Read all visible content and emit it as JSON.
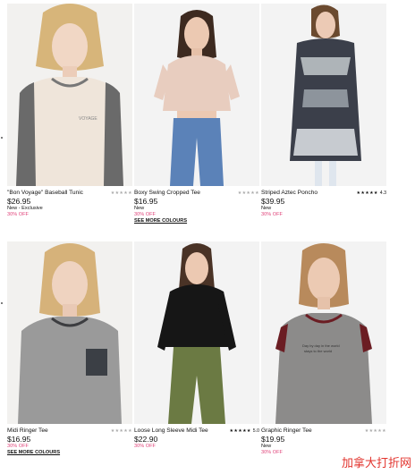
{
  "products": [
    {
      "name": "\"Bon Voyage\" Baseball Tunic",
      "price": "$26.95",
      "tag": "New - Exclusive",
      "discount": "30% OFF",
      "more": "",
      "stars": "★★★★★",
      "rating": ""
    },
    {
      "name": "Boxy Swing Cropped Tee",
      "price": "$16.95",
      "tag": "New",
      "discount": "30% OFF",
      "more": "SEE MORE COLOURS",
      "stars": "★★★★★",
      "rating": ""
    },
    {
      "name": "Striped Aztec Poncho",
      "price": "$39.95",
      "tag": "New",
      "discount": "30% OFF",
      "more": "",
      "stars": "★★★★★",
      "rating": "4.3"
    },
    {
      "name": "Midi Ringer Tee",
      "price": "$16.95",
      "tag": "",
      "discount": "30% OFF",
      "more": "SEE MORE COLOURS",
      "stars": "★★★★★",
      "rating": ""
    },
    {
      "name": "Loose Long Sleeve Midi Tee",
      "price": "$22.90",
      "tag": "",
      "discount": "30% OFF",
      "more": "",
      "stars": "★★★★★",
      "rating": "5.0"
    },
    {
      "name": "Graphic Ringer Tee",
      "price": "$19.95",
      "tag": "New",
      "discount": "30% OFF",
      "more": "",
      "stars": "★★★★★",
      "rating": ""
    }
  ],
  "watermark": "加拿大打折网",
  "colors": {
    "discount": "#e0457b",
    "watermark": "#e2342e"
  }
}
